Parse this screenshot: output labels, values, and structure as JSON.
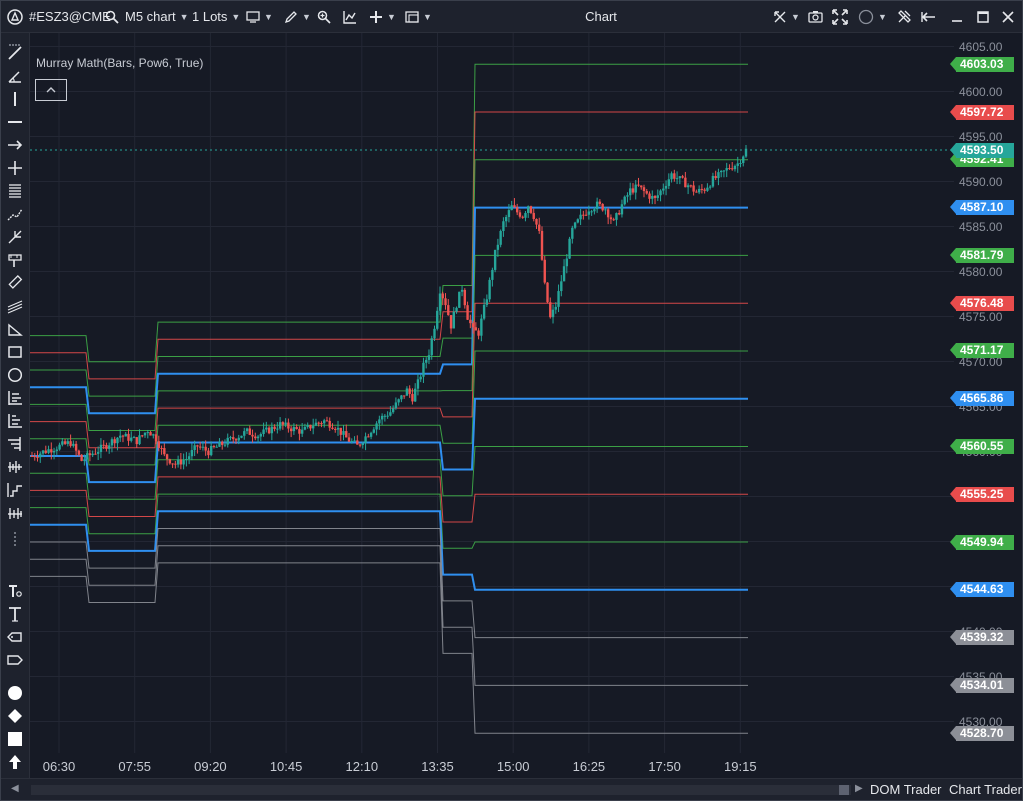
{
  "toolbar": {
    "symbol": "#ESZ3@CME",
    "chart_type": "M5 chart",
    "lots": "1 Lots",
    "title": "Chart"
  },
  "indicator": {
    "label": "Murray Math(Bars, Pow6, True)"
  },
  "chart_data": {
    "type": "candlestick",
    "instrument": "#ESZ3@CME",
    "timeframe": "M5",
    "x_ticks": [
      "06:30",
      "07:55",
      "09:20",
      "10:45",
      "12:10",
      "13:35",
      "15:00",
      "16:25",
      "17:50",
      "19:15"
    ],
    "y_ticks": [
      4605.0,
      4600.0,
      4595.0,
      4590.0,
      4585.0,
      4580.0,
      4575.0,
      4570.0,
      4565.0,
      4560.0,
      4555.0,
      4550.0,
      4545.0,
      4540.0,
      4535.0,
      4530.0
    ],
    "ylim": [
      4526.5,
      4606.5
    ],
    "last_price": 4593.5,
    "murray_levels": [
      {
        "value": 4603.03,
        "color": "#3fae49"
      },
      {
        "value": 4597.72,
        "color": "#e84c4c"
      },
      {
        "value": 4592.41,
        "color": "#3fae49"
      },
      {
        "value": 4587.1,
        "color": "#2f8ff0"
      },
      {
        "value": 4581.79,
        "color": "#3fae49"
      },
      {
        "value": 4576.48,
        "color": "#e84c4c"
      },
      {
        "value": 4571.17,
        "color": "#3fae49"
      },
      {
        "value": 4565.86,
        "color": "#2f8ff0"
      },
      {
        "value": 4560.55,
        "color": "#3fae49"
      },
      {
        "value": 4555.25,
        "color": "#e84c4c"
      },
      {
        "value": 4549.94,
        "color": "#3fae49"
      },
      {
        "value": 4544.63,
        "color": "#2f8ff0"
      },
      {
        "value": 4539.32,
        "color": "#8c8f97"
      },
      {
        "value": 4534.01,
        "color": "#8c8f97"
      },
      {
        "value": 4528.7,
        "color": "#8c8f97"
      }
    ],
    "price_path": [
      [
        0,
        4559.5
      ],
      [
        6,
        4560.2
      ],
      [
        14,
        4561.0
      ],
      [
        18,
        4559.0
      ],
      [
        22,
        4559.8
      ],
      [
        26,
        4560.5
      ],
      [
        32,
        4561.8
      ],
      [
        38,
        4561.2
      ],
      [
        42,
        4562.4
      ],
      [
        45,
        4561.5
      ],
      [
        48,
        4559.5
      ],
      [
        52,
        4558.6
      ],
      [
        56,
        4559.2
      ],
      [
        60,
        4560.6
      ],
      [
        64,
        4560.0
      ],
      [
        70,
        4561.0
      ],
      [
        74,
        4561.6
      ],
      [
        78,
        4562.2
      ],
      [
        82,
        4561.8
      ],
      [
        86,
        4562.4
      ],
      [
        90,
        4563.0
      ],
      [
        94,
        4562.6
      ],
      [
        98,
        4562.2
      ],
      [
        102,
        4563.0
      ],
      [
        106,
        4563.4
      ],
      [
        110,
        4562.8
      ],
      [
        114,
        4561.5
      ],
      [
        118,
        4560.6
      ],
      [
        122,
        4562.0
      ],
      [
        126,
        4563.6
      ],
      [
        130,
        4564.4
      ],
      [
        134,
        4566.0
      ],
      [
        136,
        4566.8
      ],
      [
        138,
        4566.0
      ],
      [
        140,
        4567.6
      ],
      [
        142,
        4569.5
      ],
      [
        144,
        4571.0
      ],
      [
        146,
        4574.0
      ],
      [
        148,
        4578.0
      ],
      [
        150,
        4576.5
      ],
      [
        152,
        4574.0
      ],
      [
        154,
        4576.4
      ],
      [
        156,
        4578.2
      ],
      [
        158,
        4575.0
      ],
      [
        160,
        4573.4
      ],
      [
        162,
        4573.2
      ],
      [
        165,
        4577.2
      ],
      [
        168,
        4582.0
      ],
      [
        171,
        4585.4
      ],
      [
        174,
        4587.2
      ],
      [
        176,
        4586.6
      ],
      [
        178,
        4586.2
      ],
      [
        180,
        4587.4
      ],
      [
        182,
        4586.2
      ],
      [
        184,
        4584.2
      ],
      [
        186,
        4578.4
      ],
      [
        188,
        4574.8
      ],
      [
        190,
        4576.2
      ],
      [
        193,
        4580.4
      ],
      [
        196,
        4584.6
      ],
      [
        199,
        4586.0
      ],
      [
        202,
        4587.0
      ],
      [
        205,
        4587.4
      ],
      [
        208,
        4587.0
      ],
      [
        211,
        4585.4
      ],
      [
        214,
        4587.4
      ],
      [
        217,
        4589.0
      ],
      [
        220,
        4589.4
      ],
      [
        223,
        4588.6
      ],
      [
        226,
        4588.0
      ],
      [
        229,
        4589.4
      ],
      [
        232,
        4590.8
      ],
      [
        235,
        4590.2
      ],
      [
        238,
        4589.6
      ],
      [
        241,
        4588.8
      ],
      [
        244,
        4589.2
      ],
      [
        247,
        4590.2
      ],
      [
        250,
        4590.8
      ],
      [
        253,
        4591.6
      ],
      [
        256,
        4592.0
      ],
      [
        259,
        4593.5
      ]
    ]
  },
  "bottom": {
    "dom_trader": "DOM Trader",
    "chart_trader": "Chart Trader"
  }
}
